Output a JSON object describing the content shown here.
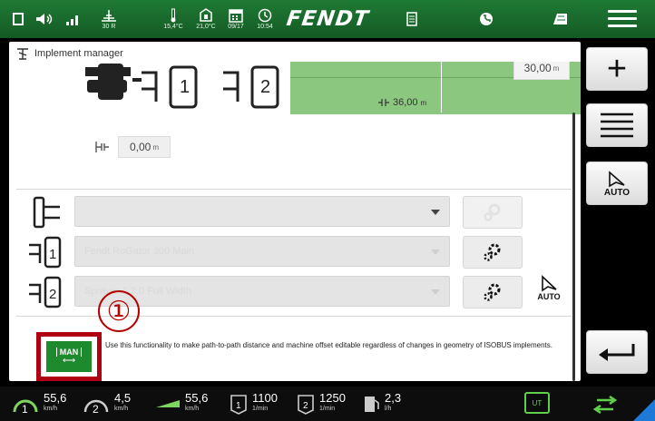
{
  "statusbar": {
    "gps_label": "30 R",
    "temp_outside": "15,4°C",
    "temp_cab": "21,0°C",
    "date": "09/17",
    "time": "10:54",
    "logo": "FENDT",
    "icons": [
      "square-icon",
      "volume-icon",
      "signal-icon",
      "gps-icon",
      "thermometer-icon",
      "cab-temp-icon",
      "calendar-icon",
      "clock-icon",
      "document-icon",
      "phone-icon",
      "field-icon",
      "menu-icon"
    ]
  },
  "panel": {
    "title": "Implement manager",
    "top_box_value": "30,00",
    "top_box_unit": "m",
    "working_width_value": "36,00",
    "working_width_unit": "m",
    "offset_value": "0,00",
    "offset_unit": "m",
    "colors": {
      "field_green": "#8cc77f",
      "highlight_red": "#b00012",
      "man_green": "#1e8a2e"
    }
  },
  "rows": [
    {
      "slot": "",
      "value": "",
      "disabled": false
    },
    {
      "slot": "1",
      "value": "Fendt RoGator 300 Main",
      "disabled": true
    },
    {
      "slot": "2",
      "value": "Sprayer 1.2.0 Full Width",
      "disabled": true
    }
  ],
  "auto_label": "AUTO",
  "callout_number": "①",
  "man_button": {
    "label": "MAN",
    "description": "Use this functionality to make path-to-path distance and machine offset editable regardless of changes in geometry of ISOBUS implements."
  },
  "side_buttons": {
    "add": "+",
    "auto": "AUTO"
  },
  "bottombar": {
    "speed1": {
      "value": "55,6",
      "unit": "km/h"
    },
    "speed2": {
      "value": "4,5",
      "unit": "km/h"
    },
    "speed3": {
      "value": "55,6",
      "unit": "km/h"
    },
    "rpm1": {
      "value": "1100",
      "unit": "1/min"
    },
    "rpm2": {
      "value": "1250",
      "unit": "1/min"
    },
    "fuel": {
      "value": "2,3",
      "unit": "l/h"
    },
    "ut_label": "UT"
  }
}
